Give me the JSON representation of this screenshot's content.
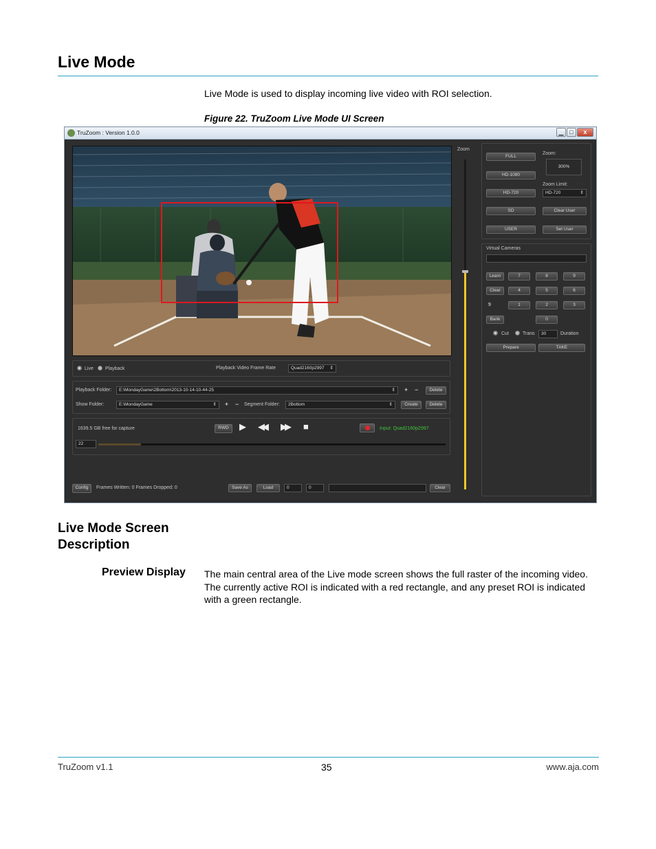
{
  "page": {
    "title": "Live Mode",
    "intro": "Live Mode is used to display incoming live video with ROI selection.",
    "figure_caption": "Figure 22. TruZoom Live Mode UI Screen"
  },
  "app": {
    "window_title": "TruZoom : Version 1.0.0",
    "window_controls": {
      "minimize": "▁",
      "maximize": "□",
      "close": "x"
    },
    "zoom_slider_label": "Zoom",
    "zoom_level": 0.66,
    "right_panel": {
      "format_buttons": [
        "FULL",
        "HD-1080",
        "HD-720",
        "SD",
        "USER"
      ],
      "zoom_label": "Zoom:",
      "zoom_value": "300%",
      "zoom_limit_label": "Zoom Limit:",
      "zoom_limit_value": "HD-720",
      "clear_user": "Clear User",
      "set_user": "Set User",
      "virtual_cameras_label": "Virtual Cameras",
      "learn": "Learn",
      "clear": "Clear",
      "bank": "Bank",
      "current_camera": "9",
      "num_pad": [
        [
          "7",
          "8",
          "9"
        ],
        [
          "4",
          "5",
          "6"
        ],
        [
          "1",
          "2",
          "3"
        ],
        [
          "0"
        ]
      ],
      "cut": "Cut",
      "trans": "Trans",
      "duration_value": "30",
      "duration_label": "Duration",
      "prepare": "Prepare",
      "take": "TAKE"
    },
    "controls": {
      "live": "Live",
      "playback": "Playback",
      "frame_rate_label": "Playback Video Frame Rate",
      "frame_rate_value": "Quad2160p2997",
      "playback_folder_label": "Playback Folder:",
      "playback_folder_value": "E:\\MondayGame\\2Bottom\\2013-10-14-10-44-25",
      "show_folder_label": "Show Folder:",
      "show_folder_value": "E:\\MondayGame",
      "segment_folder_label": "Segment Folder:",
      "segment_folder_value": "2Bottom",
      "plus": "+",
      "minus": "−",
      "delete": "Delete",
      "create": "Create",
      "free_space": "1639.5 GB free for capture",
      "rwd": "RWD",
      "input_status": "Input: Quad2160p2997",
      "frame_counter": "22",
      "config": "Config",
      "frames_status": "Frames Written: 0 Frames Dropped: 0",
      "save_as": "Save As",
      "load": "Load",
      "spin1": "0",
      "spin2": "0",
      "clear_btn": "Clear"
    },
    "colors": {
      "roi_active": "#e0171f",
      "zoom_fill": "#f2c62c",
      "input_status": "#3ec43e"
    }
  },
  "section": {
    "title_line1": "Live Mode Screen",
    "title_line2": "Description",
    "term": "Preview Display",
    "description": "The main central area of the Live mode screen shows the full raster of the incoming video. The currently active ROI is indicated with a red rectangle, and any preset ROI is indicated with a green rectangle."
  },
  "footer": {
    "left": "TruZoom v1.1",
    "page_number": "35",
    "right": "www.aja.com"
  }
}
